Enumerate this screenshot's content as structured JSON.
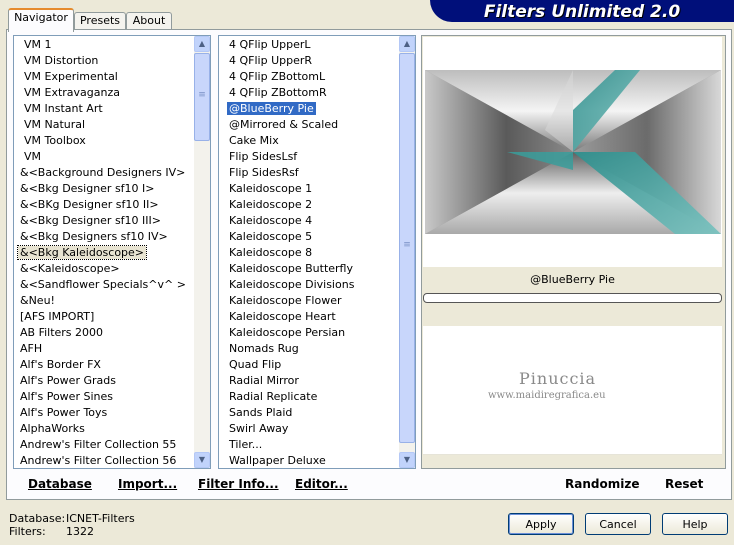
{
  "banner": {
    "title": "Filters Unlimited 2.0"
  },
  "tabs": [
    {
      "label": "Navigator"
    },
    {
      "label": "Presets"
    },
    {
      "label": "About"
    }
  ],
  "categories": [
    "VM 1",
    "VM Distortion",
    "VM Experimental",
    "VM Extravaganza",
    "VM Instant Art",
    "VM Natural",
    "VM Toolbox",
    "VM",
    "&<Background Designers IV>",
    "&<Bkg Designer sf10 I>",
    "&<BKg Designer sf10 II>",
    "&<Bkg Designer sf10 III>",
    "&<Bkg Designers sf10 IV>",
    "&<Bkg Kaleidoscope>",
    "&<Kaleidoscope>",
    "&<Sandflower Specials^v^ >",
    "&Neu!",
    "[AFS IMPORT]",
    "AB Filters 2000",
    "AFH",
    "Alf's Border FX",
    "Alf's Power Grads",
    "Alf's Power Sines",
    "Alf's Power Toys",
    "AlphaWorks",
    "Andrew's Filter Collection 55",
    "Andrew's Filter Collection 56"
  ],
  "filters": [
    "4 QFlip UpperL",
    "4 QFlip UpperR",
    "4 QFlip ZBottomL",
    "4 QFlip ZBottomR",
    "@BlueBerry Pie",
    "@Mirrored & Scaled",
    "Cake Mix",
    "Flip SidesLsf",
    "Flip SidesRsf",
    "Kaleidoscope 1",
    "Kaleidoscope 2",
    "Kaleidoscope 4",
    "Kaleidoscope 5",
    "Kaleidoscope 8",
    "Kaleidoscope Butterfly",
    "Kaleidoscope Divisions",
    "Kaleidoscope Flower",
    "Kaleidoscope Heart",
    "Kaleidoscope Persian",
    "Nomads Rug",
    "Quad Flip",
    "Radial Mirror",
    "Radial Replicate",
    "Sands Plaid",
    "Swirl Away",
    "Tiler...",
    "Wallpaper Deluxe"
  ],
  "selected_filter_name": "@BlueBerry Pie",
  "watermark": {
    "name": "Pinuccia",
    "url": "www.maidiregrafica.eu"
  },
  "left_buttons": {
    "database": "Database",
    "import": "Import...",
    "filter_info": "Filter Info...",
    "editor": "Editor..."
  },
  "right_buttons": {
    "randomize": "Randomize",
    "reset": "Reset"
  },
  "status": {
    "database_label": "Database:",
    "database_value": "ICNET-Filters",
    "filters_label": "Filters:",
    "filters_value": "1322"
  },
  "dialog_buttons": {
    "apply": "Apply",
    "cancel": "Cancel",
    "help": "Help"
  },
  "colors": {
    "selection": "#316ac5",
    "banner": "#000f7a",
    "teal": "#3a9d9b"
  }
}
